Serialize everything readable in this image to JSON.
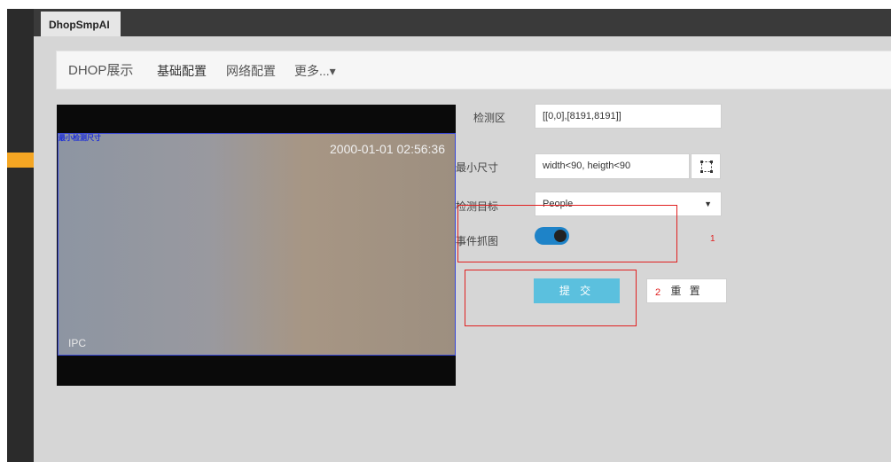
{
  "app": {
    "tab_label": "DhopSmpAI"
  },
  "menu": {
    "home": "DHOP展示",
    "basic": "基础配置",
    "network": "网络配置",
    "more": "更多...▾"
  },
  "video": {
    "roi_label": "最小检测尺寸",
    "timestamp": "2000-01-01 02:56:36",
    "camera_label": "IPC"
  },
  "form": {
    "zone_label": "检测区",
    "zone_value": "[[0,0],[8191,8191]]",
    "minsize_label": "最小尺寸",
    "minsize_value": "width<90, heigth<90",
    "target_label": "检测目标",
    "target_value": "People",
    "capture_label": "事件抓图",
    "capture_enabled": true,
    "submit_label": "提 交",
    "reset_label": "重 置"
  },
  "annotations": {
    "box1_number": "1",
    "box2_number": "2"
  },
  "colors": {
    "accent_blue": "#1e83c8",
    "submit_blue": "#5bc0de",
    "annotation_red": "#e02020",
    "rail_orange": "#f5a623"
  }
}
